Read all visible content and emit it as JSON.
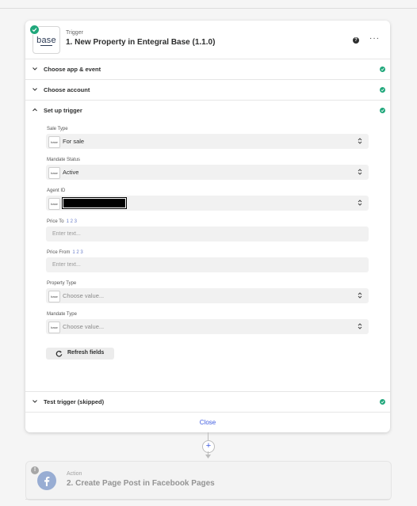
{
  "trigger": {
    "kind": "Trigger",
    "title": "1. New Property in Entegral Base (1.1.0)",
    "logo_text": "base",
    "status": "complete"
  },
  "sections": {
    "choose_app": "Choose app & event",
    "choose_account": "Choose account",
    "set_up_trigger": "Set up trigger",
    "test_trigger": "Test trigger (skipped)"
  },
  "fields": {
    "sale_type": {
      "label": "Sale Type",
      "value": "For sale"
    },
    "mandate_status": {
      "label": "Mandate Status",
      "value": "Active"
    },
    "agent_id": {
      "label": "Agent ID",
      "value": ""
    },
    "price_to": {
      "label": "Price To",
      "hint": "1 2 3",
      "placeholder": "Enter text..."
    },
    "price_from": {
      "label": "Price From",
      "hint": "1 2 3",
      "placeholder": "Enter text..."
    },
    "property_type": {
      "label": "Property Type",
      "placeholder": "Choose value..."
    },
    "mandate_type": {
      "label": "Mandate Type",
      "placeholder": "Choose value..."
    }
  },
  "app_icon_text": "base",
  "buttons": {
    "refresh": "Refresh fields",
    "close": "Close"
  },
  "action": {
    "kind": "Action",
    "title": "2. Create Page Post in Facebook Pages",
    "warning": "!"
  },
  "icons": {
    "help": "help-icon",
    "more": "more-icon",
    "chevron": "chevron-icon",
    "check": "check-icon",
    "refresh": "refresh-icon",
    "plus": "plus-icon",
    "facebook": "facebook-icon"
  },
  "colors": {
    "success": "#20a77b",
    "link": "#3e5be0",
    "background": "#f5f5f5"
  }
}
